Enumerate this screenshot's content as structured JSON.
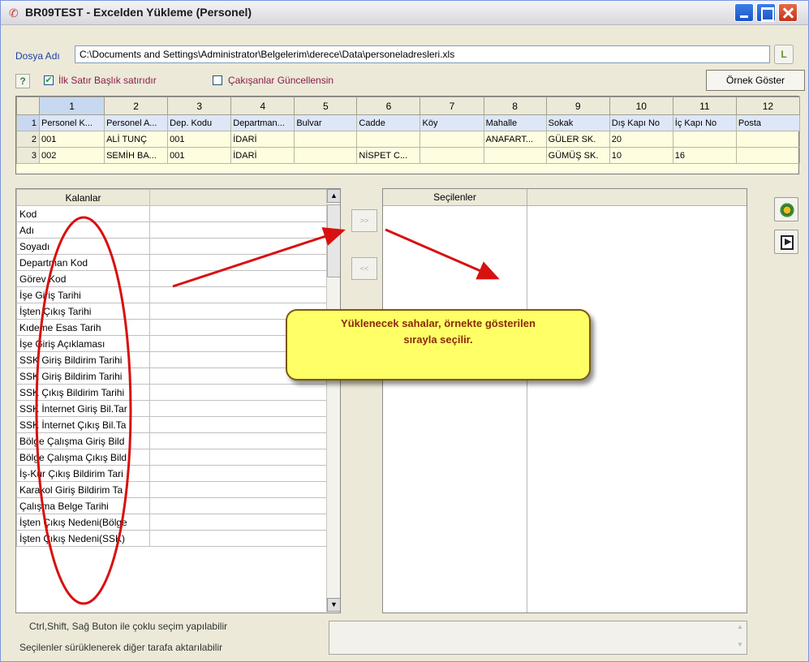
{
  "window": {
    "title": "BR09TEST - Excelden Yükleme (Personel)"
  },
  "file": {
    "label": "Dosya Adı",
    "path": "C:\\Documents and Settings\\Administrator\\Belgelerim\\derece\\Data\\personeladresleri.xls",
    "browse_label": "L"
  },
  "options": {
    "help_label": "?",
    "first_row_header": {
      "label": "İlk Satır Başlık satırıdır",
      "checked": true,
      "mark": "✔"
    },
    "update_conflicts": {
      "label": "Çakışanlar Güncellensin",
      "checked": false
    },
    "sample_button": "Örnek Göster"
  },
  "grid": {
    "columns": [
      "1",
      "2",
      "3",
      "4",
      "5",
      "6",
      "7",
      "8",
      "9",
      "10",
      "11",
      "12"
    ],
    "rows": [
      {
        "num": "1",
        "cells": [
          "Personel K...",
          "Personel A...",
          "Dep. Kodu",
          "Departman...",
          "Bulvar",
          "Cadde",
          "Köy",
          "Mahalle",
          "Sokak",
          "Dış Kapı No",
          "İç Kapı No",
          "Posta"
        ]
      },
      {
        "num": "2",
        "cells": [
          "001",
          "ALİ TUNÇ",
          "001",
          "İDARİ",
          "",
          "",
          "",
          "ANAFART...",
          "GÜLER SK.",
          "20",
          "",
          ""
        ]
      },
      {
        "num": "3",
        "cells": [
          "002",
          "SEMİH BA...",
          "001",
          "İDARİ",
          "",
          "NİSPET C...",
          "",
          "",
          "GÜMÜŞ SK.",
          "10",
          "16",
          ""
        ]
      }
    ]
  },
  "left_panel": {
    "header": "Kalanlar",
    "items": [
      "Kod",
      "Adı",
      "Soyadı",
      "Departman Kod",
      "Görev Kod",
      "İşe Giriş Tarihi",
      "İşten Çıkış Tarihi",
      "Kıdeme Esas Tarih",
      "İşe Giriş Açıklaması",
      "SSK Giriş Bildirim Tarihi",
      "SSK Giriş Bildirim Tarihi",
      "SSK Çıkış Bildirim Tarihi",
      "SSK İnternet Giriş Bil.Tar",
      "SSK İnternet Çıkış Bil.Ta",
      "Bölge Çalışma Giriş Bild",
      "Bölge Çalışma Çıkış Bild",
      "İş-Kur Çıkış Bildirim Tari",
      "Karakol Giriş Bildirim Ta",
      "Çalışma Belge Tarihi",
      "İşten Çıkış Nedeni(Bölge",
      "İşten Çıkış Nedeni(SSK)"
    ]
  },
  "move": {
    "right": ">>",
    "left": "<<"
  },
  "right_panel": {
    "header": "Seçilenler"
  },
  "callout": {
    "line1": "Yüklenecek sahalar, örnekte gösterilen",
    "line2": "sırayla seçilir."
  },
  "hints": {
    "line1": "Ctrl,Shift, Sağ Buton ile çoklu seçim yapılabilir",
    "line2": "Seçilenler sürüklenerek diğer tarafa aktarılabilir"
  },
  "colors": {
    "annotation": "#d81010",
    "callout_bg": "#ffff66",
    "grid_bg": "#fffde0"
  },
  "icons": {
    "run": "gear-icon",
    "exit": "exit-icon"
  }
}
